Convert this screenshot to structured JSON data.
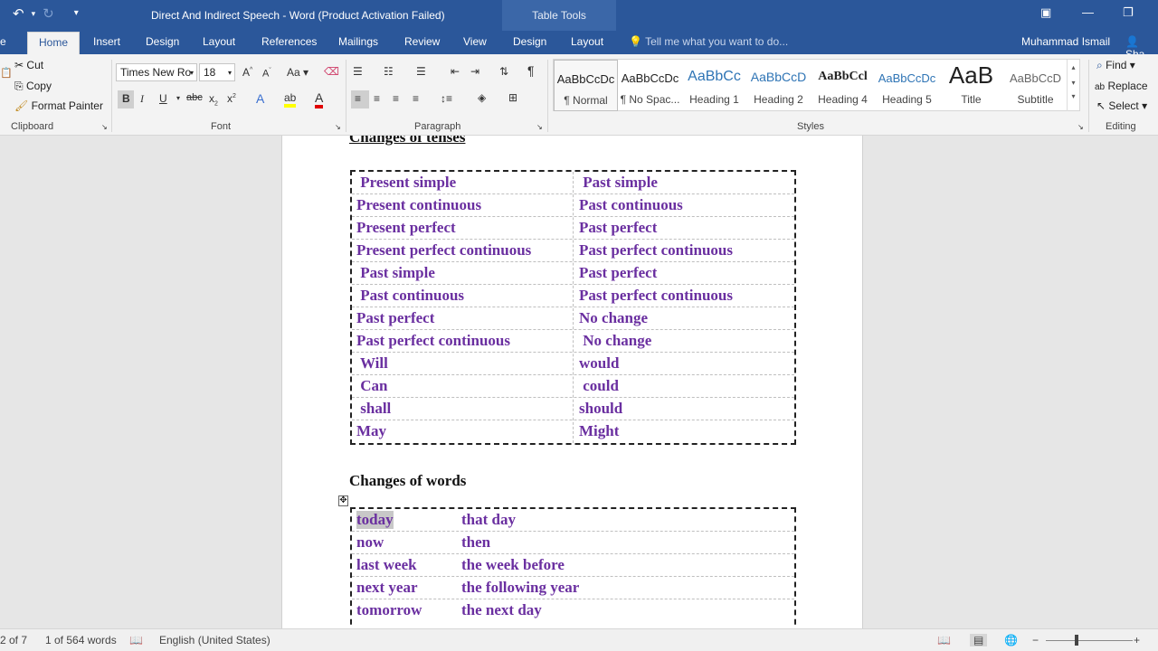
{
  "titlebar": {
    "title": "Direct And Indirect Speech - Word (Product Activation Failed)",
    "context_tab": "Table Tools",
    "undo_icon": "undo-icon",
    "redo_icon": "redo-icon"
  },
  "tabs": [
    {
      "label": "e"
    },
    {
      "label": "Home"
    },
    {
      "label": "Insert"
    },
    {
      "label": "Design"
    },
    {
      "label": "Layout"
    },
    {
      "label": "References"
    },
    {
      "label": "Mailings"
    },
    {
      "label": "Review"
    },
    {
      "label": "View"
    },
    {
      "label": "Design"
    },
    {
      "label": "Layout"
    }
  ],
  "tell_me": "Tell me what you want to do...",
  "user": "Muhammad Ismail",
  "share": "Sha",
  "clipboard": {
    "cut": "Cut",
    "copy": "Copy",
    "format_painter": "Format Painter",
    "label": "Clipboard"
  },
  "font": {
    "name": "Times New Ro",
    "size": "18",
    "case": "Aa",
    "label": "Font"
  },
  "paragraph": {
    "label": "Paragraph"
  },
  "styles": {
    "label": "Styles",
    "items": [
      {
        "preview": "AaBbCcDc",
        "name": "¶ Normal"
      },
      {
        "preview": "AaBbCcDc",
        "name": "¶ No Spac..."
      },
      {
        "preview": "AaBbCc",
        "name": "Heading 1"
      },
      {
        "preview": "AaBbCcD",
        "name": "Heading 2"
      },
      {
        "preview": "AaBbCcl",
        "name": "Heading 4"
      },
      {
        "preview": "AaBbCcDc",
        "name": "Heading 5"
      },
      {
        "preview": "AaB",
        "name": "Title"
      },
      {
        "preview": "AaBbCcD",
        "name": "Subtitle"
      }
    ]
  },
  "editing": {
    "find": "Find",
    "replace": "Replace",
    "select": "Select",
    "label": "Editing"
  },
  "document": {
    "heading1": "Changes of tenses",
    "tenses": [
      [
        " Present simple",
        " Past simple"
      ],
      [
        "Present continuous",
        "Past continuous"
      ],
      [
        "Present perfect",
        "Past perfect"
      ],
      [
        "Present perfect continuous",
        "Past perfect continuous"
      ],
      [
        " Past simple",
        "Past perfect"
      ],
      [
        " Past continuous",
        "Past perfect continuous"
      ],
      [
        "Past perfect",
        "No change"
      ],
      [
        "Past perfect continuous",
        " No change"
      ],
      [
        " Will",
        "would"
      ],
      [
        " Can",
        " could"
      ],
      [
        " shall",
        "should"
      ],
      [
        "May",
        "Might"
      ]
    ],
    "heading2": "Changes of words",
    "words": [
      [
        "today",
        "that day"
      ],
      [
        "now",
        "then"
      ],
      [
        "last week",
        "the week before"
      ],
      [
        "next year",
        "the following year"
      ],
      [
        "tomorrow",
        "the next day"
      ]
    ]
  },
  "status": {
    "page": "2 of 7",
    "words": "1 of 564 words",
    "language": "English (United States)"
  },
  "colors": {
    "accent": "#2b579a",
    "table_text": "#6a2fa0"
  }
}
